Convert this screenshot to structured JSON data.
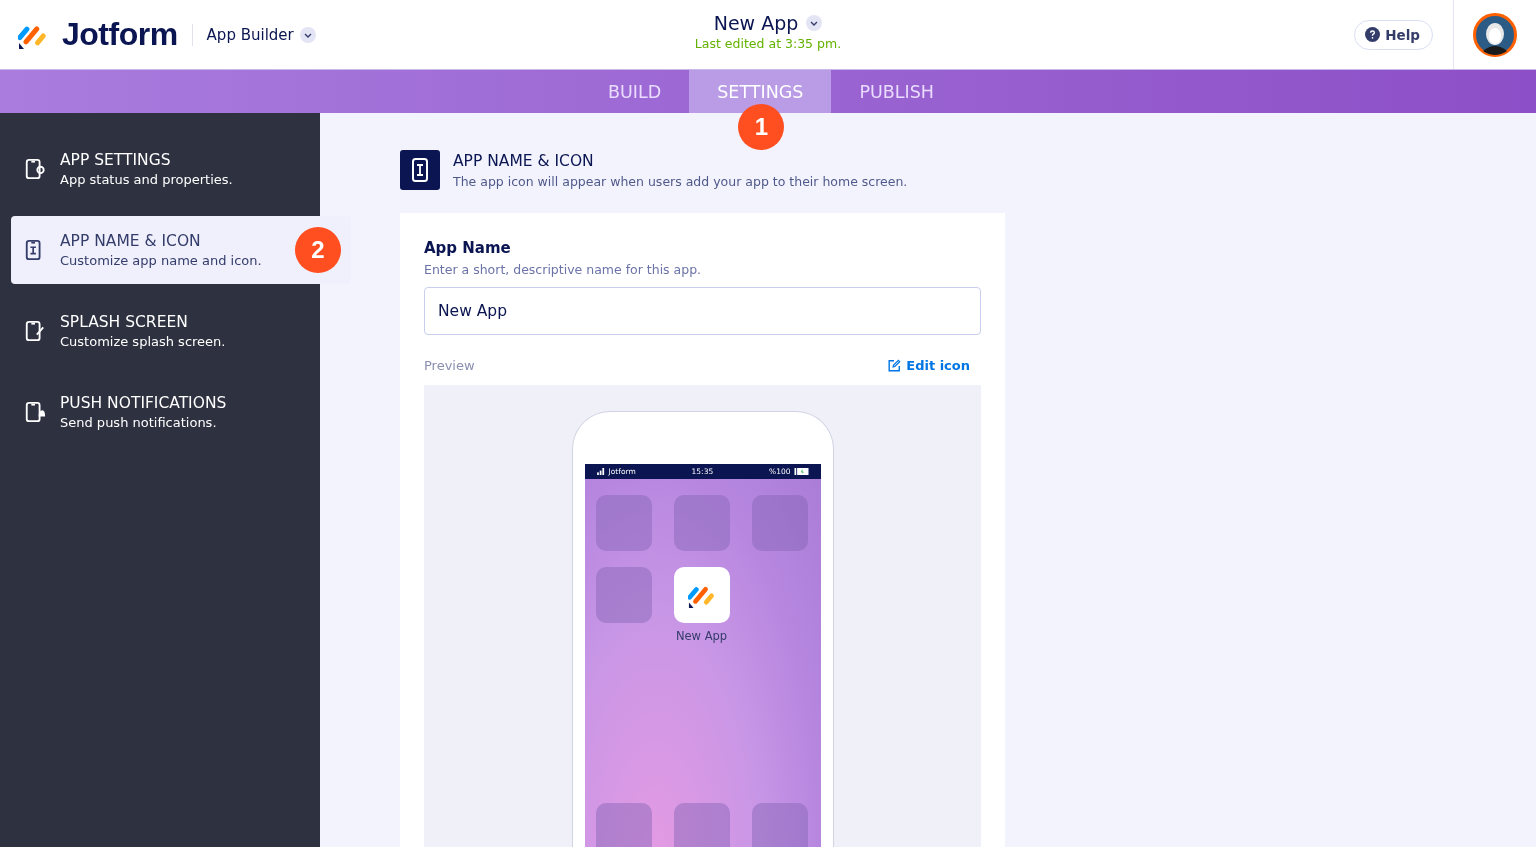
{
  "header": {
    "brand": "Jotform",
    "product": "App Builder",
    "app_title": "New App",
    "last_edited": "Last edited at 3:35 pm.",
    "help": "Help"
  },
  "tabs": [
    {
      "label": "BUILD",
      "selected": false
    },
    {
      "label": "SETTINGS",
      "selected": true,
      "badge": "1"
    },
    {
      "label": "PUBLISH",
      "selected": false
    }
  ],
  "sidebar": {
    "items": [
      {
        "title": "APP SETTINGS",
        "subtitle": "App status and properties.",
        "selected": false
      },
      {
        "title": "APP NAME & ICON",
        "subtitle": "Customize app name and icon.",
        "selected": true,
        "badge": "2"
      },
      {
        "title": "SPLASH SCREEN",
        "subtitle": "Customize splash screen.",
        "selected": false
      },
      {
        "title": "PUSH NOTIFICATIONS",
        "subtitle": "Send push notifications.",
        "selected": false
      }
    ]
  },
  "section": {
    "title": "APP NAME & ICON",
    "description": "The app icon will appear when users add your app to their home screen."
  },
  "field": {
    "label": "App Name",
    "hint": "Enter a short, descriptive name for this app.",
    "value": "New App"
  },
  "preview": {
    "label": "Preview",
    "edit_link": "Edit icon",
    "phone": {
      "carrier": "Jotform",
      "time": "15:35",
      "battery": "%100",
      "app_label": "New App"
    }
  }
}
